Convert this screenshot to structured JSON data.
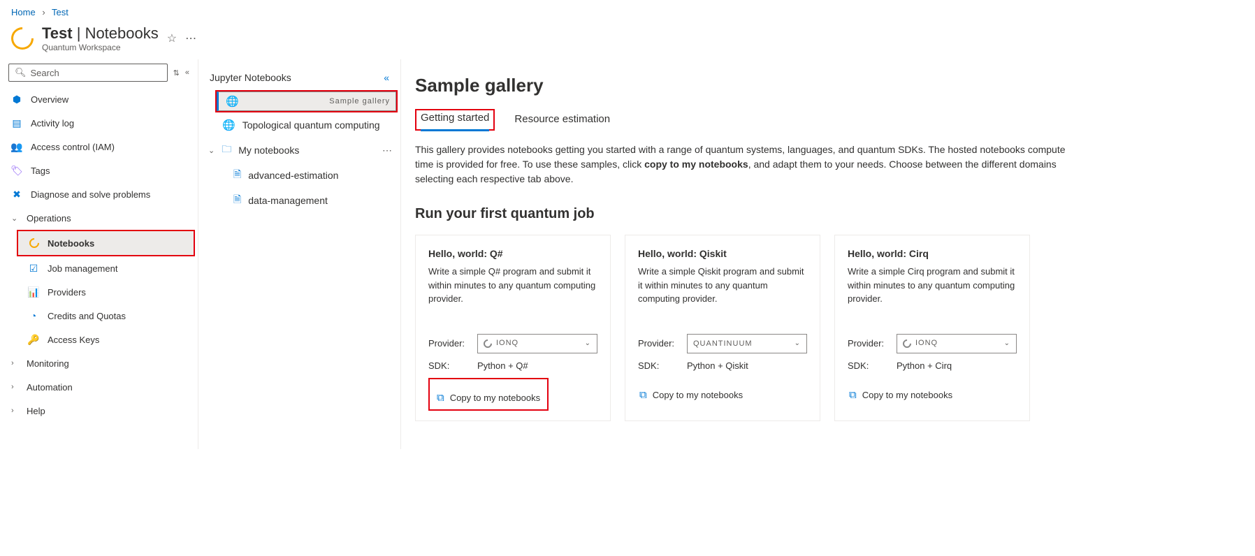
{
  "breadcrumb": {
    "home": "Home",
    "current": "Test"
  },
  "header": {
    "name": "Test",
    "section": "Notebooks",
    "subtitle": "Quantum Workspace"
  },
  "search": {
    "placeholder": "Search"
  },
  "nav": {
    "overview": "Overview",
    "activity": "Activity log",
    "iam": "Access control (IAM)",
    "tags": "Tags",
    "diagnose": "Diagnose and solve problems",
    "operations": "Operations",
    "notebooks": "Notebooks",
    "jobs": "Job management",
    "providers": "Providers",
    "credits": "Credits and Quotas",
    "keys": "Access Keys",
    "monitoring": "Monitoring",
    "automation": "Automation",
    "help": "Help"
  },
  "mid": {
    "title": "Jupyter Notebooks",
    "sample": "Sample gallery",
    "topo": "Topological quantum computing",
    "mynb": "My notebooks",
    "file1": "advanced-estimation",
    "file2": "data-management"
  },
  "main": {
    "title": "Sample gallery",
    "tab1": "Getting started",
    "tab2": "Resource estimation",
    "desc_a": "This gallery provides notebooks getting you started with a range of quantum systems, languages, and quantum SDKs. The hosted notebooks compute time is provided for free. To use these samples, click ",
    "desc_bold": "copy to my notebooks",
    "desc_b": ", and adapt them to your needs. Choose between the different domains selecting each respective tab above.",
    "section": "Run your first quantum job",
    "provider_lbl": "Provider:",
    "sdk_lbl": "SDK:",
    "copy": "Copy to my notebooks",
    "cards": [
      {
        "title": "Hello, world: Q#",
        "desc": "Write a simple Q# program and submit it within minutes to any quantum computing provider.",
        "provider": "IONQ",
        "sdk": "Python + Q#"
      },
      {
        "title": "Hello, world: Qiskit",
        "desc": "Write a simple Qiskit program and submit it within minutes to any quantum computing provider.",
        "provider": "QUANTINUUM",
        "sdk": "Python + Qiskit"
      },
      {
        "title": "Hello, world: Cirq",
        "desc": "Write a simple Cirq program and submit it within minutes to any quantum computing provider.",
        "provider": "IONQ",
        "sdk": "Python + Cirq"
      }
    ]
  }
}
